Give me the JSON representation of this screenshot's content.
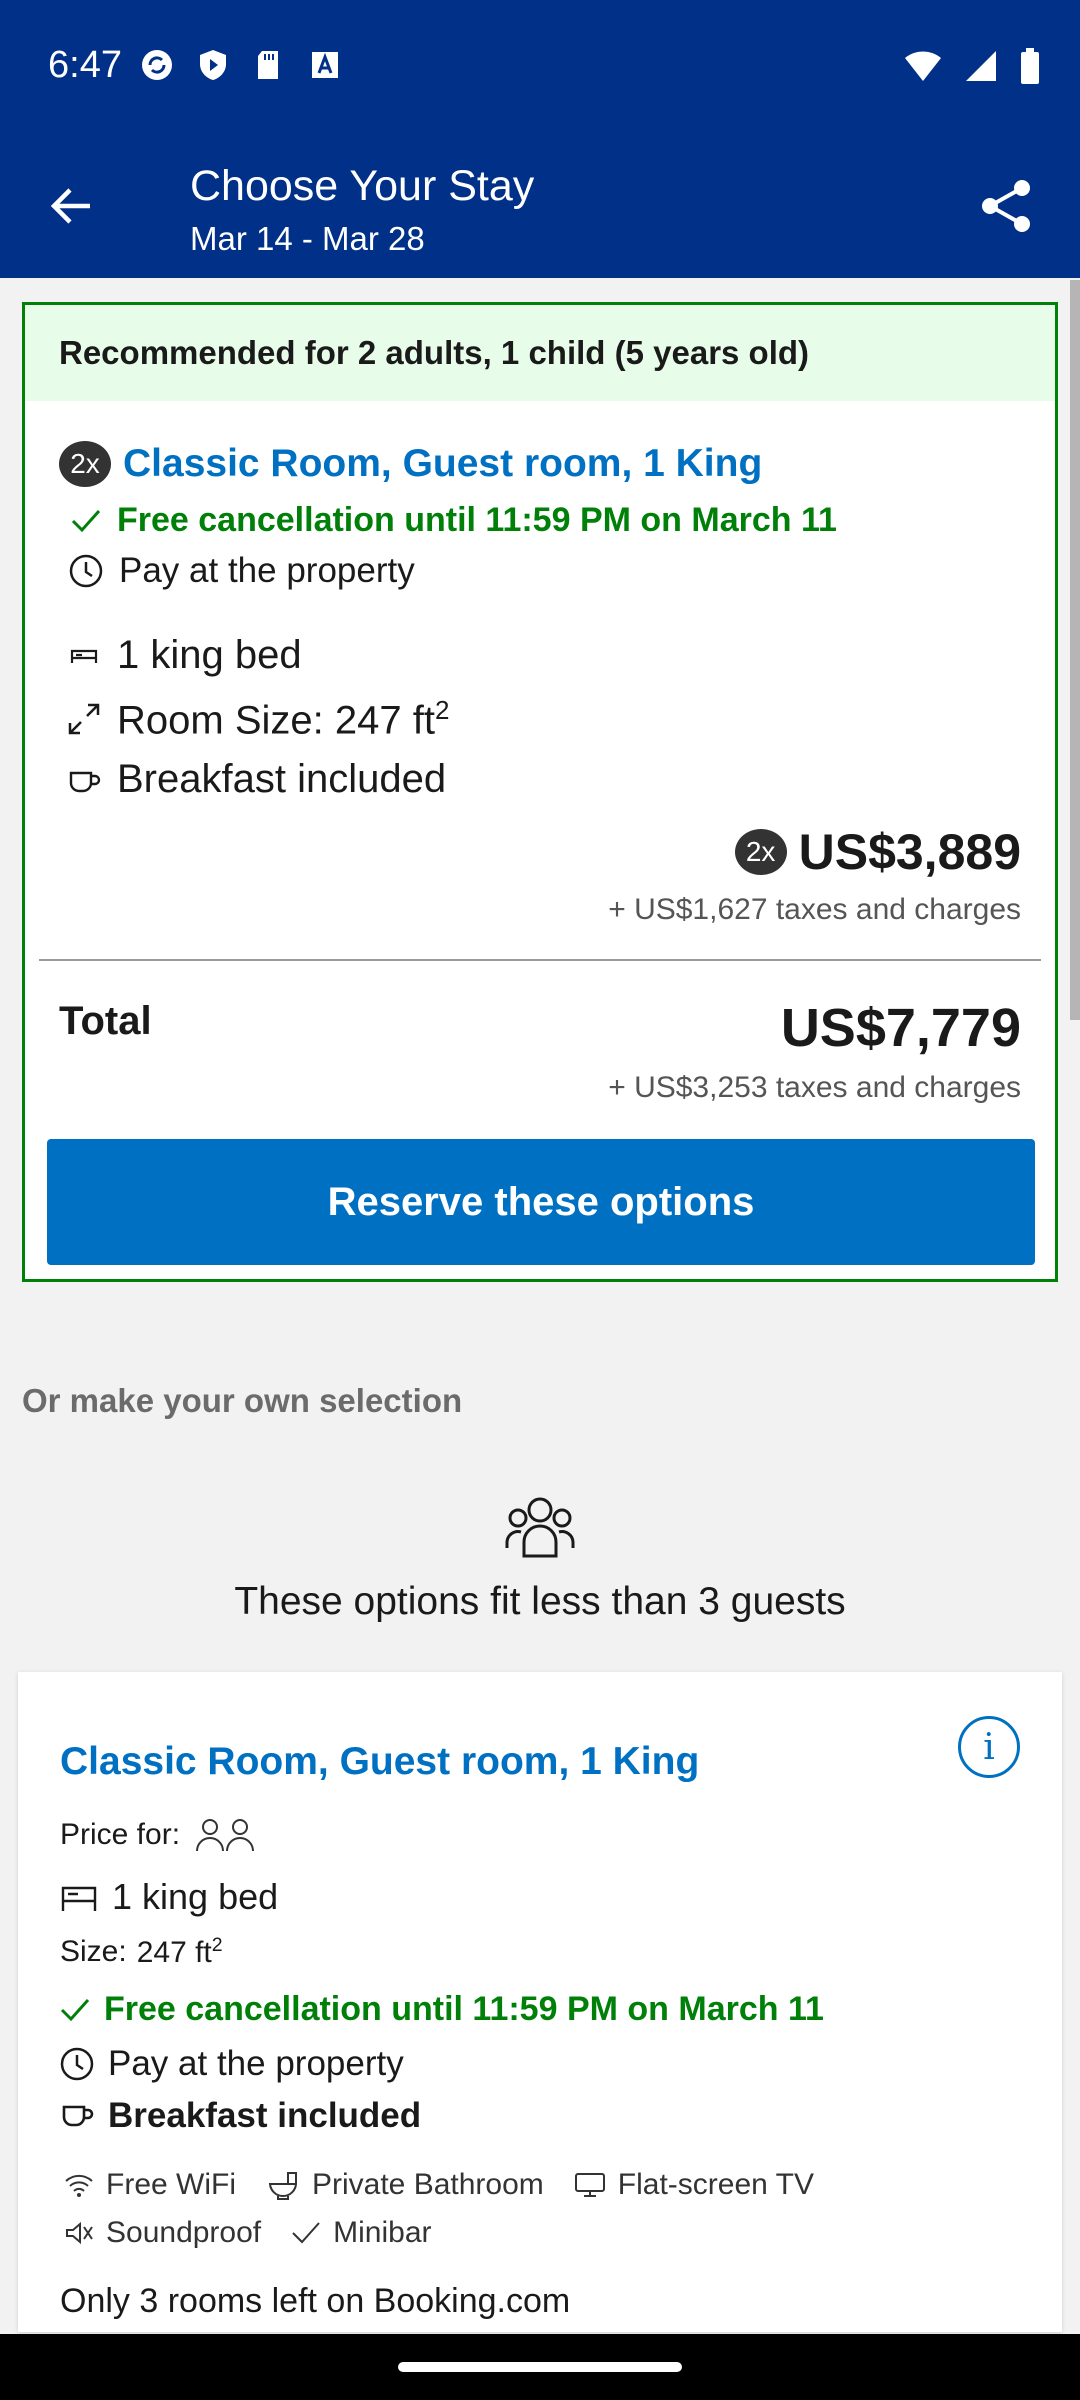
{
  "status_bar": {
    "time": "6:47"
  },
  "app_bar": {
    "title": "Choose Your Stay",
    "dates": "Mar 14 - Mar 28"
  },
  "recommended": {
    "header": "Recommended for 2 adults, 1 child (5 years old)",
    "quantity_badge": "2x",
    "room_title": "Classic Room, Guest room, 1 King",
    "free_cancellation": "Free cancellation until 11:59 PM on March 11",
    "payment": "Pay at the property",
    "bed": "1 king bed",
    "room_size_label": "Room Size: 247 ft",
    "room_size_sup": "2",
    "breakfast": "Breakfast included",
    "price_badge": "2x",
    "price": "US$3,889",
    "price_taxes": "+ US$1,627 taxes and charges",
    "total_label": "Total",
    "total_price": "US$7,779",
    "total_taxes": "+ US$3,253 taxes and charges",
    "reserve_button": "Reserve these options"
  },
  "own_selection": {
    "heading": "Or make your own selection",
    "fit_notice": "These options fit less than 3 guests"
  },
  "room_card": {
    "title": "Classic Room, Guest room, 1 King",
    "price_for_label": "Price for:",
    "bed": "1 king bed",
    "size_label": "Size:",
    "size_value": "247 ft",
    "size_sup": "2",
    "free_cancellation": "Free cancellation until 11:59 PM on March 11",
    "payment": "Pay at the property",
    "breakfast": "Breakfast included",
    "amenities_row1": [
      "Free WiFi",
      "Private Bathroom",
      "Flat-screen TV"
    ],
    "amenities_row2": [
      "Soundproof",
      "Minibar"
    ],
    "availability": "Only 3 rooms left on Booking.com"
  },
  "colors": {
    "brand_dark": "#003087",
    "accent_blue": "#0071c2",
    "success_green": "#008009",
    "recommended_bg": "#e7fde9"
  }
}
